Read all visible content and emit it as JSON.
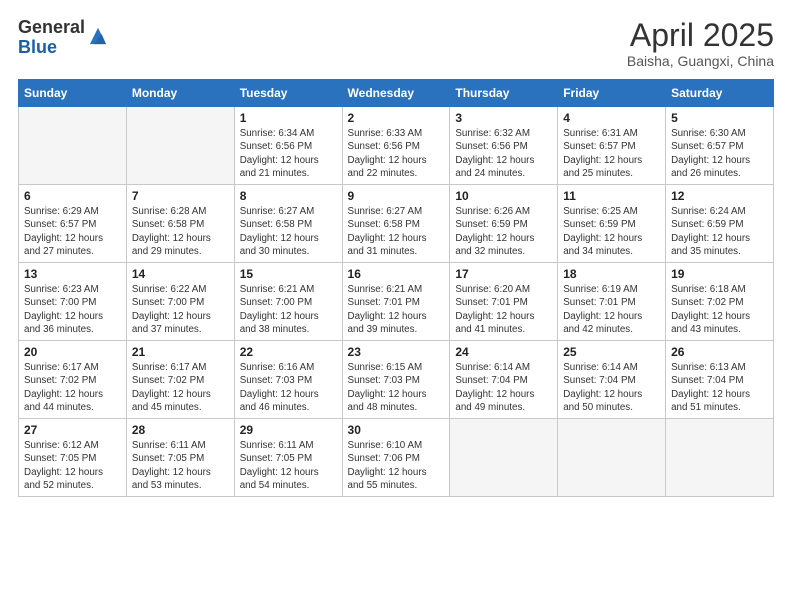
{
  "header": {
    "logo_general": "General",
    "logo_blue": "Blue",
    "month_title": "April 2025",
    "subtitle": "Baisha, Guangxi, China"
  },
  "weekdays": [
    "Sunday",
    "Monday",
    "Tuesday",
    "Wednesday",
    "Thursday",
    "Friday",
    "Saturday"
  ],
  "weeks": [
    [
      {
        "day": "",
        "info": ""
      },
      {
        "day": "",
        "info": ""
      },
      {
        "day": "1",
        "info": "Sunrise: 6:34 AM\nSunset: 6:56 PM\nDaylight: 12 hours and 21 minutes."
      },
      {
        "day": "2",
        "info": "Sunrise: 6:33 AM\nSunset: 6:56 PM\nDaylight: 12 hours and 22 minutes."
      },
      {
        "day": "3",
        "info": "Sunrise: 6:32 AM\nSunset: 6:56 PM\nDaylight: 12 hours and 24 minutes."
      },
      {
        "day": "4",
        "info": "Sunrise: 6:31 AM\nSunset: 6:57 PM\nDaylight: 12 hours and 25 minutes."
      },
      {
        "day": "5",
        "info": "Sunrise: 6:30 AM\nSunset: 6:57 PM\nDaylight: 12 hours and 26 minutes."
      }
    ],
    [
      {
        "day": "6",
        "info": "Sunrise: 6:29 AM\nSunset: 6:57 PM\nDaylight: 12 hours and 27 minutes."
      },
      {
        "day": "7",
        "info": "Sunrise: 6:28 AM\nSunset: 6:58 PM\nDaylight: 12 hours and 29 minutes."
      },
      {
        "day": "8",
        "info": "Sunrise: 6:27 AM\nSunset: 6:58 PM\nDaylight: 12 hours and 30 minutes."
      },
      {
        "day": "9",
        "info": "Sunrise: 6:27 AM\nSunset: 6:58 PM\nDaylight: 12 hours and 31 minutes."
      },
      {
        "day": "10",
        "info": "Sunrise: 6:26 AM\nSunset: 6:59 PM\nDaylight: 12 hours and 32 minutes."
      },
      {
        "day": "11",
        "info": "Sunrise: 6:25 AM\nSunset: 6:59 PM\nDaylight: 12 hours and 34 minutes."
      },
      {
        "day": "12",
        "info": "Sunrise: 6:24 AM\nSunset: 6:59 PM\nDaylight: 12 hours and 35 minutes."
      }
    ],
    [
      {
        "day": "13",
        "info": "Sunrise: 6:23 AM\nSunset: 7:00 PM\nDaylight: 12 hours and 36 minutes."
      },
      {
        "day": "14",
        "info": "Sunrise: 6:22 AM\nSunset: 7:00 PM\nDaylight: 12 hours and 37 minutes."
      },
      {
        "day": "15",
        "info": "Sunrise: 6:21 AM\nSunset: 7:00 PM\nDaylight: 12 hours and 38 minutes."
      },
      {
        "day": "16",
        "info": "Sunrise: 6:21 AM\nSunset: 7:01 PM\nDaylight: 12 hours and 39 minutes."
      },
      {
        "day": "17",
        "info": "Sunrise: 6:20 AM\nSunset: 7:01 PM\nDaylight: 12 hours and 41 minutes."
      },
      {
        "day": "18",
        "info": "Sunrise: 6:19 AM\nSunset: 7:01 PM\nDaylight: 12 hours and 42 minutes."
      },
      {
        "day": "19",
        "info": "Sunrise: 6:18 AM\nSunset: 7:02 PM\nDaylight: 12 hours and 43 minutes."
      }
    ],
    [
      {
        "day": "20",
        "info": "Sunrise: 6:17 AM\nSunset: 7:02 PM\nDaylight: 12 hours and 44 minutes."
      },
      {
        "day": "21",
        "info": "Sunrise: 6:17 AM\nSunset: 7:02 PM\nDaylight: 12 hours and 45 minutes."
      },
      {
        "day": "22",
        "info": "Sunrise: 6:16 AM\nSunset: 7:03 PM\nDaylight: 12 hours and 46 minutes."
      },
      {
        "day": "23",
        "info": "Sunrise: 6:15 AM\nSunset: 7:03 PM\nDaylight: 12 hours and 48 minutes."
      },
      {
        "day": "24",
        "info": "Sunrise: 6:14 AM\nSunset: 7:04 PM\nDaylight: 12 hours and 49 minutes."
      },
      {
        "day": "25",
        "info": "Sunrise: 6:14 AM\nSunset: 7:04 PM\nDaylight: 12 hours and 50 minutes."
      },
      {
        "day": "26",
        "info": "Sunrise: 6:13 AM\nSunset: 7:04 PM\nDaylight: 12 hours and 51 minutes."
      }
    ],
    [
      {
        "day": "27",
        "info": "Sunrise: 6:12 AM\nSunset: 7:05 PM\nDaylight: 12 hours and 52 minutes."
      },
      {
        "day": "28",
        "info": "Sunrise: 6:11 AM\nSunset: 7:05 PM\nDaylight: 12 hours and 53 minutes."
      },
      {
        "day": "29",
        "info": "Sunrise: 6:11 AM\nSunset: 7:05 PM\nDaylight: 12 hours and 54 minutes."
      },
      {
        "day": "30",
        "info": "Sunrise: 6:10 AM\nSunset: 7:06 PM\nDaylight: 12 hours and 55 minutes."
      },
      {
        "day": "",
        "info": ""
      },
      {
        "day": "",
        "info": ""
      },
      {
        "day": "",
        "info": ""
      }
    ]
  ]
}
